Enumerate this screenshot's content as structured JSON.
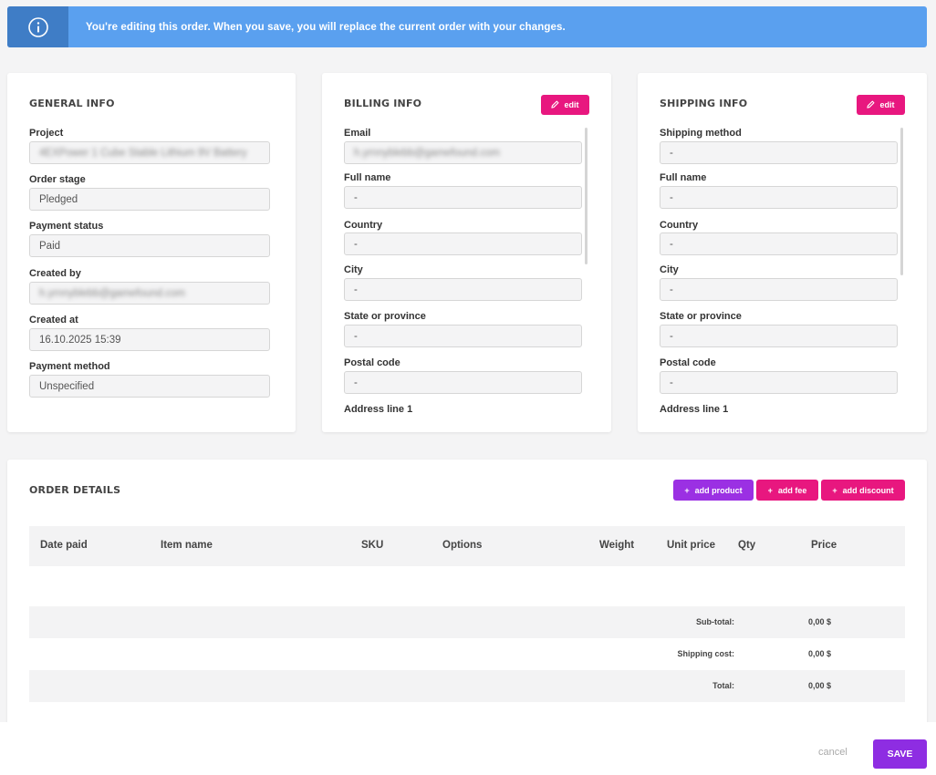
{
  "banner": {
    "icon": "info-icon",
    "message": "You're editing this order. When you save, you will replace the current order with your changes.",
    "color": "#5aa0ef"
  },
  "general_info": {
    "title": "GENERAL INFO",
    "fields": [
      {
        "label": "Project",
        "value": "4EXPower 1 Cube Stable Lithium 9V Battery"
      },
      {
        "label": "Order stage",
        "value": "Pledged"
      },
      {
        "label": "Payment status",
        "value": "Paid"
      },
      {
        "label": "Created by",
        "value": "h.yrnnyblebb@gamefound.com"
      },
      {
        "label": "Created at",
        "value": "16.10.2025 15:39"
      },
      {
        "label": "Payment method",
        "value": "Unspecified"
      }
    ]
  },
  "billing_info": {
    "title": "BILLING INFO",
    "edit_label": "edit",
    "fields": [
      {
        "label": "Email",
        "value": "h.yrnnyblebb@gamefound.com"
      },
      {
        "label": "Full name",
        "value": "-"
      },
      {
        "label": "Country",
        "value": "-"
      },
      {
        "label": "City",
        "value": "-"
      },
      {
        "label": "State or province",
        "value": "-"
      },
      {
        "label": "Postal code",
        "value": "-"
      },
      {
        "label": "Address line 1",
        "value": "-"
      }
    ]
  },
  "shipping_info": {
    "title": "SHIPPING INFO",
    "edit_label": "edit",
    "fields": [
      {
        "label": "Shipping method",
        "value": "-"
      },
      {
        "label": "Full name",
        "value": "-"
      },
      {
        "label": "Country",
        "value": "-"
      },
      {
        "label": "City",
        "value": "-"
      },
      {
        "label": "State or province",
        "value": "-"
      },
      {
        "label": "Postal code",
        "value": "-"
      },
      {
        "label": "Address line 1",
        "value": "-"
      }
    ]
  },
  "order_details": {
    "title": "ORDER DETAILS",
    "buttons": {
      "add_product": "add product",
      "add_fee": "add fee",
      "add_discount": "add discount"
    },
    "columns": [
      "Date paid",
      "Item name",
      "SKU",
      "Options",
      "Weight",
      "Unit price",
      "Qty",
      "Price"
    ],
    "summary": [
      {
        "label": "Sub-total:",
        "value": "0,00 $"
      },
      {
        "label": "Shipping cost:",
        "value": "0,00 $"
      },
      {
        "label": "Total:",
        "value": "0,00 $"
      }
    ]
  },
  "footer": {
    "cancel_label": "cancel",
    "save_label": "SAVE"
  },
  "colors": {
    "accent_pink": "#e8177f",
    "accent_purple": "#8e2de2",
    "banner_blue": "#5aa0ef"
  }
}
